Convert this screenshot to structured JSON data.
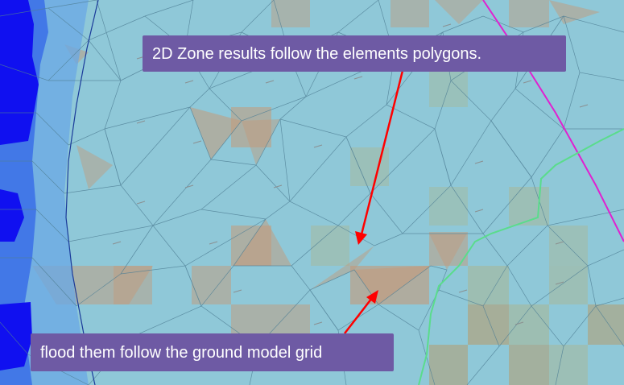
{
  "colors": {
    "background": "#8fc8d8",
    "mesh_line": "#4f7f95",
    "deep_water": "#1010f0",
    "mid_water": "#3a6ee8",
    "shallow_water": "#6aa8e6",
    "flood_cell": "#c49a7a",
    "dry_cell": "#a7b89a",
    "boundary_magenta": "#e020d0",
    "boundary_green": "#5adc8c",
    "arrow": "#ff0000",
    "callout_bg": "#6e5aa4",
    "callout_text": "#ffffff"
  },
  "annotations": {
    "top_label": "2D Zone results follow the elements polygons.",
    "bottom_label": "flood them follow the ground model grid"
  }
}
